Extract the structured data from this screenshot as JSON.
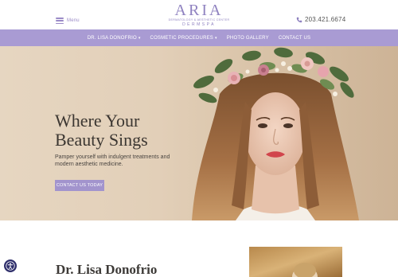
{
  "header": {
    "menu_label": "Menu",
    "logo": {
      "main": "ARIA",
      "subtitle": "DERMATOLOGY & AESTHETIC CENTER",
      "tagline": "DERMSPA"
    },
    "phone": "203.421.6674"
  },
  "nav": {
    "items": [
      {
        "label": "Dr. Lisa Donofrio",
        "has_dropdown": true
      },
      {
        "label": "Cosmetic Procedures",
        "has_dropdown": true
      },
      {
        "label": "Photo Gallery",
        "has_dropdown": false
      },
      {
        "label": "Contact Us",
        "has_dropdown": false
      }
    ]
  },
  "hero": {
    "title_line1": "Where Your",
    "title_line2": "Beauty Sings",
    "subtitle": "Pamper yourself with indulgent treatments and modern aesthetic medicine.",
    "cta_label": "Contact Us Today"
  },
  "about": {
    "heading": "Dr. Lisa Donofrio"
  },
  "colors": {
    "brand_purple": "#a99bd3",
    "button_purple": "#a294cd",
    "logo_purple": "#8f82c0",
    "accessibility_navy": "#2f2f6b"
  },
  "icons": {
    "menu": "hamburger-icon",
    "phone": "phone-icon",
    "dropdown": "chevron-down-icon",
    "accessibility": "accessibility-icon"
  }
}
